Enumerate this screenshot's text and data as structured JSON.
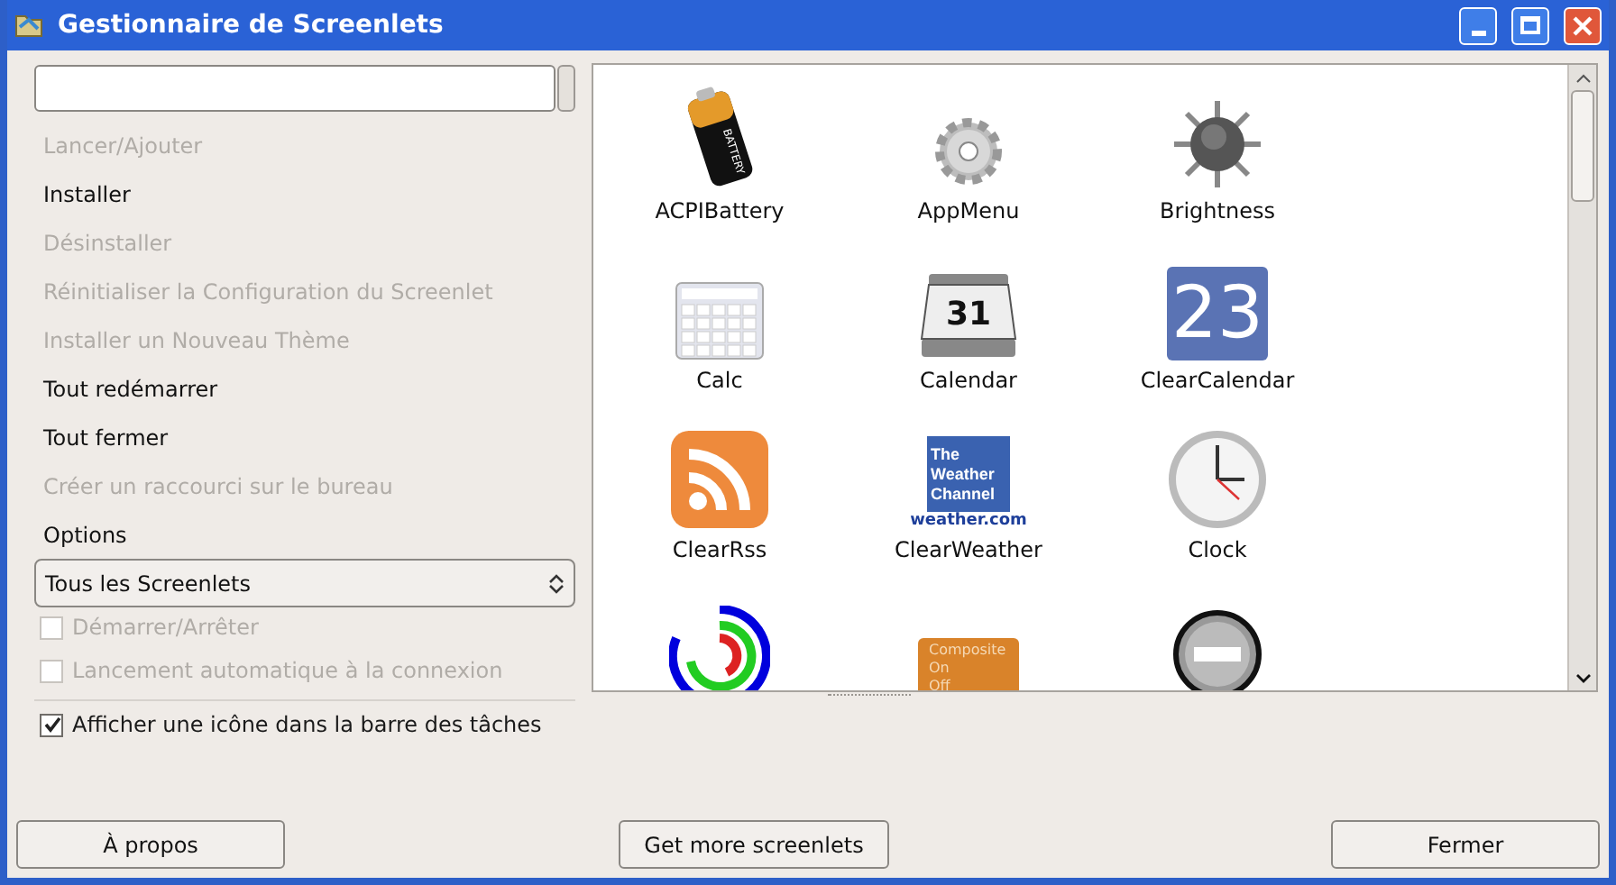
{
  "window": {
    "title": "Gestionnaire de Screenlets"
  },
  "actions": [
    {
      "label": "Lancer/Ajouter",
      "disabled": true
    },
    {
      "label": "Installer",
      "disabled": false
    },
    {
      "label": "Désinstaller",
      "disabled": true
    },
    {
      "label": "Réinitialiser la Configuration du Screenlet",
      "disabled": true
    },
    {
      "label": "Installer un Nouveau Thème",
      "disabled": true
    },
    {
      "label": "Tout redémarrer",
      "disabled": false
    },
    {
      "label": "Tout fermer",
      "disabled": false
    },
    {
      "label": "Créer un raccourci sur le bureau",
      "disabled": true
    }
  ],
  "options": {
    "heading": "Options",
    "filter": "Tous les Screenlets",
    "checkboxes": [
      {
        "label": "Démarrer/Arrêter",
        "checked": false,
        "disabled": true
      },
      {
        "label": "Lancement automatique à la connexion",
        "checked": false,
        "disabled": true
      }
    ],
    "tray_checkbox": {
      "label": "Afficher une icône dans la barre des tâches",
      "checked": true,
      "disabled": false
    }
  },
  "screenlets": [
    {
      "name": "ACPIBattery",
      "kind": "battery",
      "icon_text": [
        "BATTERY"
      ]
    },
    {
      "name": "AppMenu",
      "kind": "gear"
    },
    {
      "name": "Brightness",
      "kind": "sun"
    },
    {
      "name": "Calc",
      "kind": "calc"
    },
    {
      "name": "Calendar",
      "kind": "calendar",
      "icon_text": [
        "31"
      ]
    },
    {
      "name": "ClearCalendar",
      "kind": "datebox",
      "icon_text": [
        "23"
      ]
    },
    {
      "name": "ClearRss",
      "kind": "rss"
    },
    {
      "name": "ClearWeather",
      "kind": "weather",
      "icon_text": [
        "The Weather Channel",
        "weather.com"
      ]
    },
    {
      "name": "Clock",
      "kind": "clock"
    },
    {
      "kind": "rings"
    },
    {
      "kind": "composite",
      "icon_text": [
        "Composite",
        "On",
        "Off"
      ]
    },
    {
      "kind": "minus"
    }
  ],
  "buttons": {
    "about": "À propos",
    "more": "Get more screenlets",
    "close": "Fermer"
  }
}
